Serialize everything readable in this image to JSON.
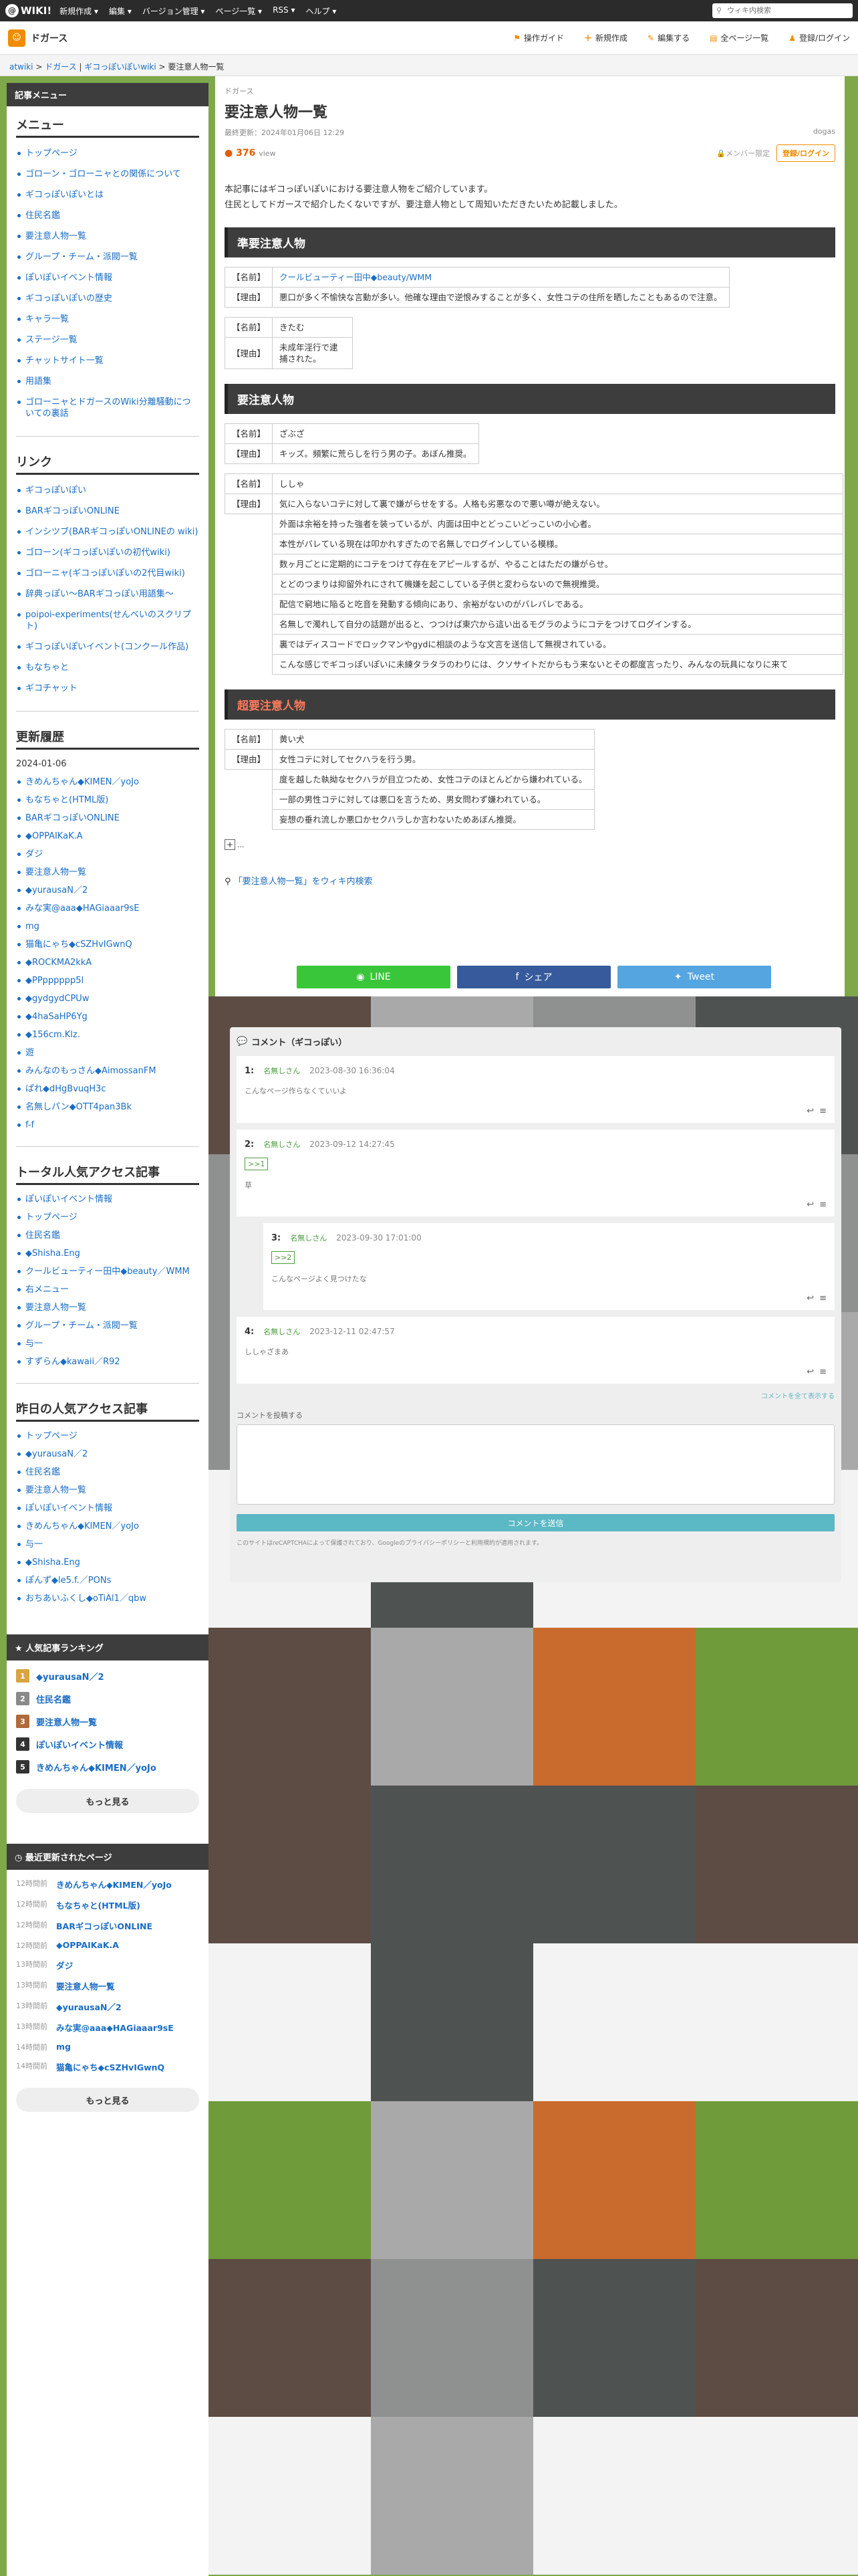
{
  "topbar": {
    "logo": "WIKI!",
    "menu": [
      "新規作成 ▾",
      "編集 ▾",
      "バージョン管理 ▾",
      "ページ一覧 ▾",
      "RSS ▾",
      "ヘルプ ▾"
    ],
    "search_placeholder": "ウィキ内検索"
  },
  "site": {
    "name": "ドガース",
    "actions": [
      "操作ガイド",
      "新規作成",
      "編集する",
      "全ページ一覧",
      "登録/ログイン"
    ]
  },
  "breadcrumb": [
    "atwiki",
    "ドガース",
    "ギコっぽいぽいwiki",
    "要注意人物一覧"
  ],
  "sidebar": {
    "box_title": "記事メニュー",
    "menu_head": "メニュー",
    "menu": [
      "トップページ",
      "ゴローン・ゴローニャとの関係について",
      "ギコっぽいぽいとは",
      "住民名鑑",
      "要注意人物一覧",
      "グループ・チーム・派閥一覧",
      "ぽいぽいイベント情報",
      "ギコっぽいぽいの歴史",
      "キャラ一覧",
      "ステージ一覧",
      "チャットサイト一覧",
      "用語集",
      "ゴローニャとドガースのWiki分離騒動についての裏話"
    ],
    "link_head": "リンク",
    "links": [
      "ギコっぽいぽい",
      "BARギコっぽいONLINE",
      "インシツブ(BARギコっぽいONLINEの wiki)",
      "ゴローン(ギコっぽいぽいの初代wiki)",
      "ゴローニャ(ギコっぽいぽいの2代目wiki)",
      "辞典っぽい〜BARギコっぽい用語集〜",
      "poipoi-experiments(せんべいのスクリプト)",
      "ギコっぽいぽいイベント(コンクール作品)",
      "もなちゃと",
      "ギコチャット"
    ],
    "update_head": "更新履歴",
    "update_date": "2024-01-06",
    "updates": [
      "きめんちゃん◆KIMEN／yoJo",
      "もなちゃと(HTML版)",
      "BARギコっぽいONLINE",
      "◆OPPAIKaK.A",
      "ダジ",
      "要注意人物一覧",
      "◆yurausaN／2",
      "みな実@aaa◆HAGiaaar9sE",
      "mg",
      "猫亀にゃち◆cSZHvIGwnQ",
      "◆ROCKMA2kkA",
      "◆PPpppppp5l",
      "◆gydgydCPUw",
      "◆4haSaHP6Yg",
      "◆156cm.Klz.",
      "遊",
      "みんなのもっさん◆AimossanFM",
      "ぱれ◆dHgBvuqH3c",
      "名無しパン◆OTT4pan3Bk",
      "f-f"
    ],
    "popular_head": "トータル人気アクセス記事",
    "popular": [
      "ぽいぽいイベント情報",
      "トップページ",
      "住民名鑑",
      "◆Shisha.Eng",
      "クールビューティー田中◆beauty／WMM",
      "右メニュー",
      "要注意人物一覧",
      "グループ・チーム・派閥一覧",
      "与一",
      "すずらん◆kawaii／R92"
    ],
    "yesterday_head": "昨日の人気アクセス記事",
    "yesterday": [
      "トップページ",
      "◆yurausaN／2",
      "住民名鑑",
      "要注意人物一覧",
      "ぽいぽいイベント情報",
      "きめんちゃん◆KIMEN／yoJo",
      "与一",
      "◆Shisha.Eng",
      "ぽんず◆le5.f.／PONs",
      "おちあいふくし◆oTiAl1／qbw"
    ],
    "ranking_head": "人気記事ランキング",
    "ranking": [
      {
        "n": "1",
        "label": "◆yurausaN／2",
        "color": "#d9a441"
      },
      {
        "n": "2",
        "label": "住民名鑑",
        "color": "#8a8a8a"
      },
      {
        "n": "3",
        "label": "要注意人物一覧",
        "color": "#b06a3b"
      },
      {
        "n": "4",
        "label": "ぽいぽいイベント情報",
        "color": "#333333"
      },
      {
        "n": "5",
        "label": "きめんちゃん◆KIMEN／yoJo",
        "color": "#333333"
      }
    ],
    "more": "もっと見る",
    "recent_head": "最近更新されたページ",
    "recent": [
      {
        "t": "12時間前",
        "label": "きめんちゃん◆KIMEN／yoJo"
      },
      {
        "t": "12時間前",
        "label": "もなちゃと(HTML版)"
      },
      {
        "t": "12時間前",
        "label": "BARギコっぽいONLINE"
      },
      {
        "t": "12時間前",
        "label": "◆OPPAIKaK.A"
      },
      {
        "t": "13時間前",
        "label": "ダジ"
      },
      {
        "t": "13時間前",
        "label": "要注意人物一覧"
      },
      {
        "t": "13時間前",
        "label": "◆yurausaN／2"
      },
      {
        "t": "13時間前",
        "label": "みな実@aaa◆HAGiaaar9sE"
      },
      {
        "t": "14時間前",
        "label": "mg"
      },
      {
        "t": "14時間前",
        "label": "猫亀にゃち◆cSZHvIGwnQ"
      }
    ],
    "more2": "もっと見る"
  },
  "main": {
    "category": "ドガース",
    "title": "要注意人物一覧",
    "updated": "最終更新：2024年01月06日 12:29",
    "author": "dogas",
    "views": "376",
    "views_unit": "view",
    "member_only": "メンバー限定",
    "register": "登録/ログイン",
    "intro1": "本記事にはギコっぽいぽいにおける要注意人物をご紹介しています。",
    "intro2": "住民としてドガースで紹介したくないですが、要注意人物として周知いただきたいため記載しました。",
    "sec1": "準要注意人物",
    "p1_name_k": "【名前】",
    "p1_name": "クールビューティー田中◆beauty/WMM",
    "p1_reason_k": "【理由】",
    "p1_reason": "悪口が多く不愉快な言動が多い。他確な理由で逆恨みすることが多く、女性コテの住所を晒したこともあるので注意。",
    "p2_name_k": "【名前】",
    "p2_name": "きたむ",
    "p2_reason_k": "【理由】",
    "p2_reason": "未成年淫行で逮捕された。",
    "sec2": "要注意人物",
    "p3_name_k": "【名前】",
    "p3_name": "ざぶざ",
    "p3_reason_k": "【理由】",
    "p3_reason": "キッズ。頻繁に荒らしを行う男の子。あぼん推奨。",
    "p4_name_k": "【名前】",
    "p4_name": "ししゃ",
    "p4_reason_k": "【理由】",
    "p4_rows": [
      "気に入らないコテに対して裏で嫌がらせをする。人格も劣悪なので悪い噂が絶えない。",
      "外面は余裕を持った強者を装っているが、内面は田中とどっこいどっこいの小心者。",
      "本性がバレている現在は叩かれすぎたので名無しでログインしている模様。",
      "数ヶ月ごとに定期的にコテをつけて存在をアピールするが、やることはただの嫌がらせ。",
      "とどのつまりは抑留外れにされて機嫌を起こしている子供と変わらないので無視推奨。",
      "配信で窮地に陥ると吃音を発動する傾向にあり、余裕がないのがバレバレである。",
      "名無しで濁れして自分の話題が出ると、つつけば東穴から這い出るモグラのようにコテをつけてログインする。",
      "裏ではディスコードでロックマンやgydに相談のような文言を送信して無視されている。",
      "こんな感じでギコっぽいぽいに未練タラタラのわりには、クソサイトだからもう来ないとその都度言ったり、みんなの玩具になりに来て"
    ],
    "sec3": "超要注意人物",
    "p5_name_k": "【名前】",
    "p5_name": "黄い犬",
    "p5_reason_k": "【理由】",
    "p5_rows": [
      "女性コテに対してセクハラを行う男。",
      "度を越した執拗なセクハラが目立つため、女性コテのほとんどから嫌われている。",
      "一部の男性コテに対しては悪口を言うため、男女問わず嫌われている。",
      "妄想の垂れ流しか悪口かセクハラしか言わないためあぼん推奨。"
    ],
    "tail": "...",
    "wiki_search": "「要注意人物一覧」をウィキ内検索",
    "share": [
      {
        "label": "LINE",
        "color": "#3ac63a"
      },
      {
        "label": "シェア",
        "color": "#365a9c"
      },
      {
        "label": "Tweet",
        "color": "#55a5e0"
      }
    ]
  },
  "comments": {
    "title": "コメント（ギコっぽい）",
    "items": [
      {
        "no": "1:",
        "name": "名無しさん",
        "date": "2023-08-30 16:36:04",
        "body": "こんなページ作らなくていいよ",
        "reply": ""
      },
      {
        "no": "2:",
        "name": "名無しさん",
        "date": "2023-09-12 14:27:45",
        "body": "草",
        "reply": ">>1"
      },
      {
        "no": "3:",
        "name": "名無しさん",
        "date": "2023-09-30 17:01:00",
        "body": "こんなページよく見つけたな",
        "reply": ">>2"
      },
      {
        "no": "4:",
        "name": "名無しさん",
        "date": "2023-12-11 02:47:57",
        "body": "ししゃざまあ",
        "reply": ""
      }
    ],
    "more_link": "コメントを全て表示する",
    "form_label": "コメントを投稿する",
    "submit": "コメントを送信",
    "note": "このサイトはreCAPTCHAによって保護されており、Googleのプライバシーポリシーと利用規約が適用されます。"
  }
}
